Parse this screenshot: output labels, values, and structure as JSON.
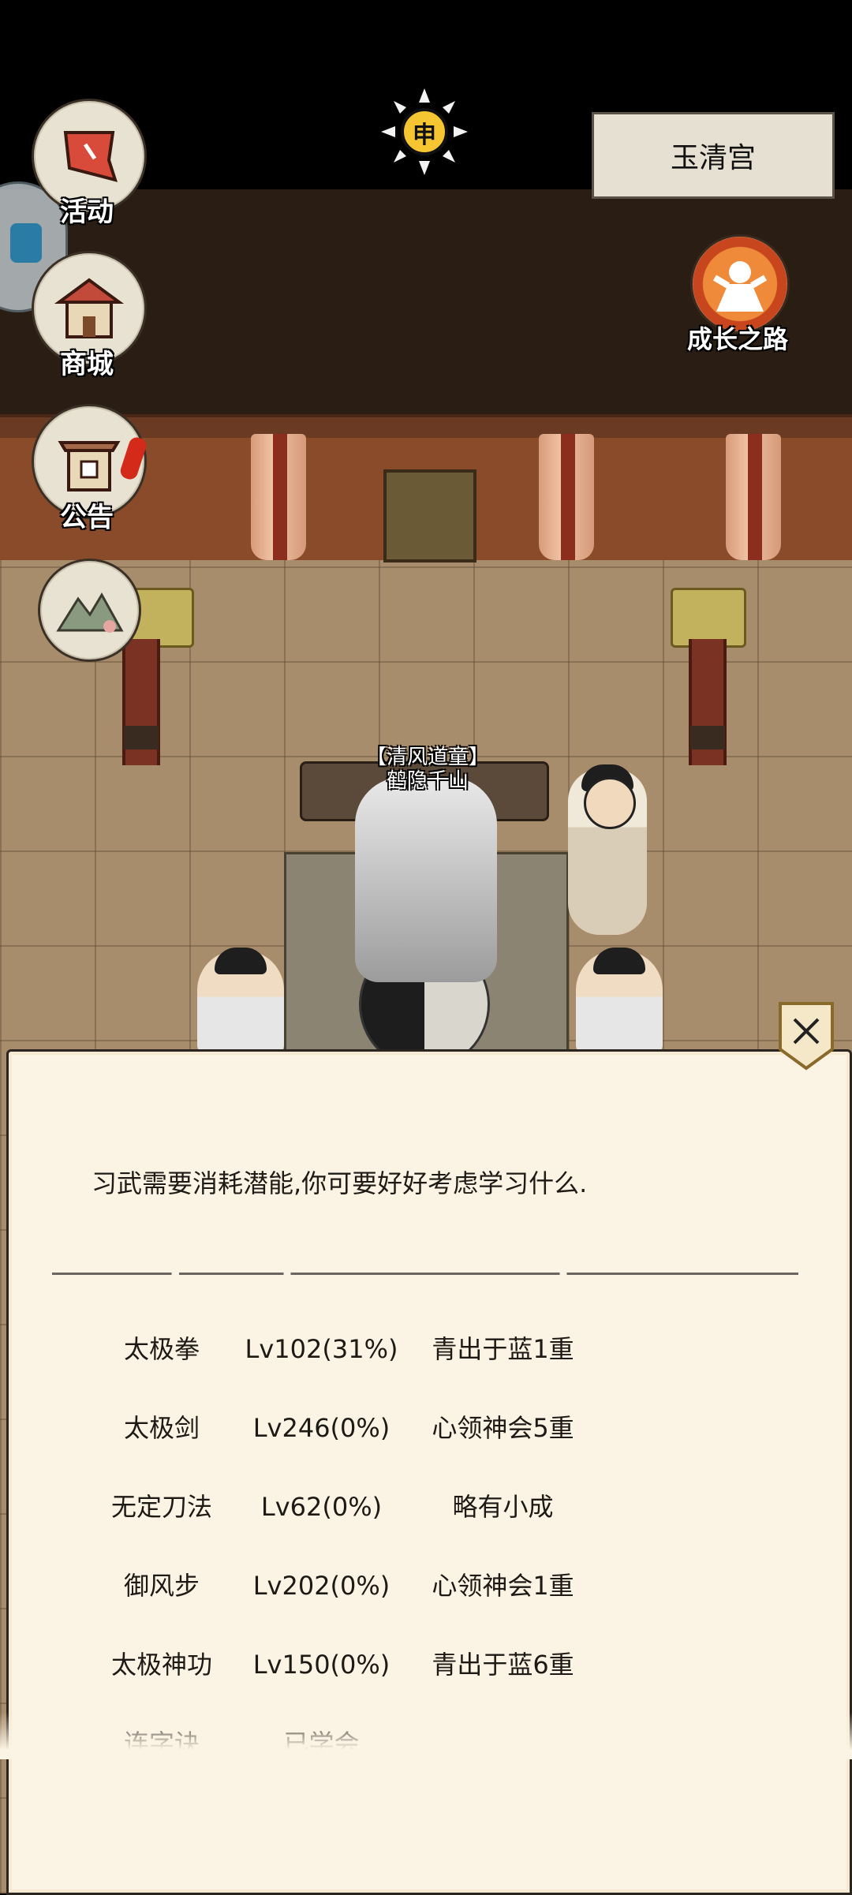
{
  "location": "玉清宫",
  "time_emblem": "申",
  "left_menu": [
    {
      "label": "活动",
      "icon": "activity-banner-icon"
    },
    {
      "label": "商城",
      "icon": "shop-building-icon"
    },
    {
      "label": "公告",
      "icon": "notice-gate-icon"
    },
    {
      "label": "",
      "icon": "landscape-scroll-icon"
    }
  ],
  "growth_path": {
    "label": "成长之路",
    "icon": "growth-figure-icon"
  },
  "npc": {
    "title": "【清风道童】",
    "name": "鹤隐千山"
  },
  "dialog": {
    "message": "习武需要消耗潜能,你可要好好考虑学习什么.",
    "close_icon": "close-x-icon",
    "skills": [
      {
        "name": "太极拳",
        "level": "Lv102(31%)",
        "rank": "青出于蓝1重"
      },
      {
        "name": "太极剑",
        "level": "Lv246(0%)",
        "rank": "心领神会5重"
      },
      {
        "name": "无定刀法",
        "level": "Lv62(0%)",
        "rank": "略有小成"
      },
      {
        "name": "御风步",
        "level": "Lv202(0%)",
        "rank": "心领神会1重"
      },
      {
        "name": "太极神功",
        "level": "Lv150(0%)",
        "rank": "青出于蓝6重"
      },
      {
        "name": "连字诀",
        "level": "已学会",
        "rank": ""
      }
    ]
  },
  "colors": {
    "panel_bg": "#fbf3e3",
    "hall_wall": "#8a4b2b",
    "floor": "#a88d6c"
  }
}
